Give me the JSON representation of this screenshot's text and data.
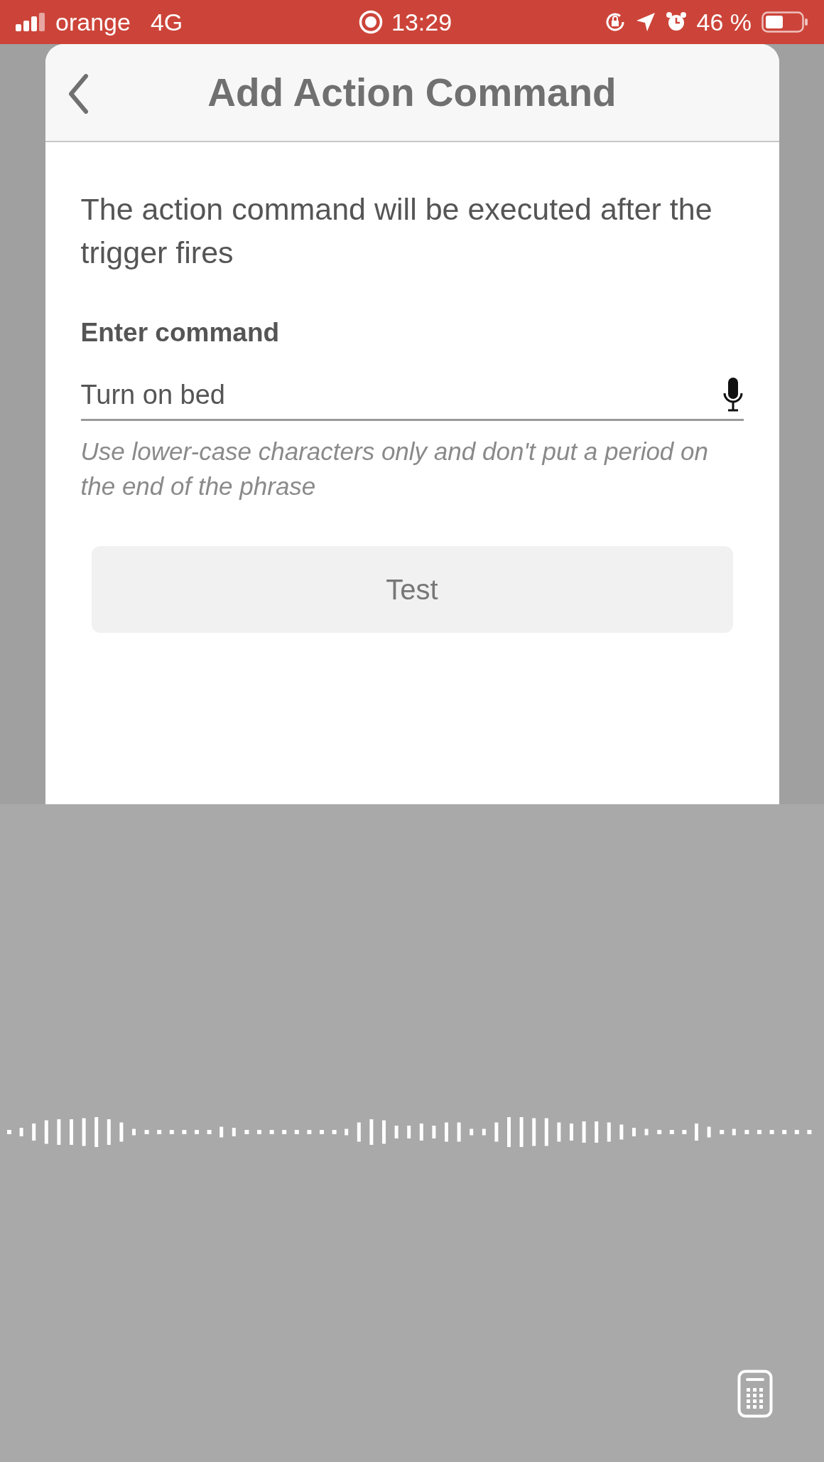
{
  "status_bar": {
    "carrier": "orange",
    "network": "4G",
    "time": "13:29",
    "battery": "46 %"
  },
  "dialog": {
    "title": "Add Action Command",
    "description": "The action command will be executed after the trigger fires",
    "field_label": "Enter command",
    "field_value": "Turn on bed",
    "hint": "Use lower-case characters only and don't put a period on the end of the phrase",
    "button": "Test"
  }
}
